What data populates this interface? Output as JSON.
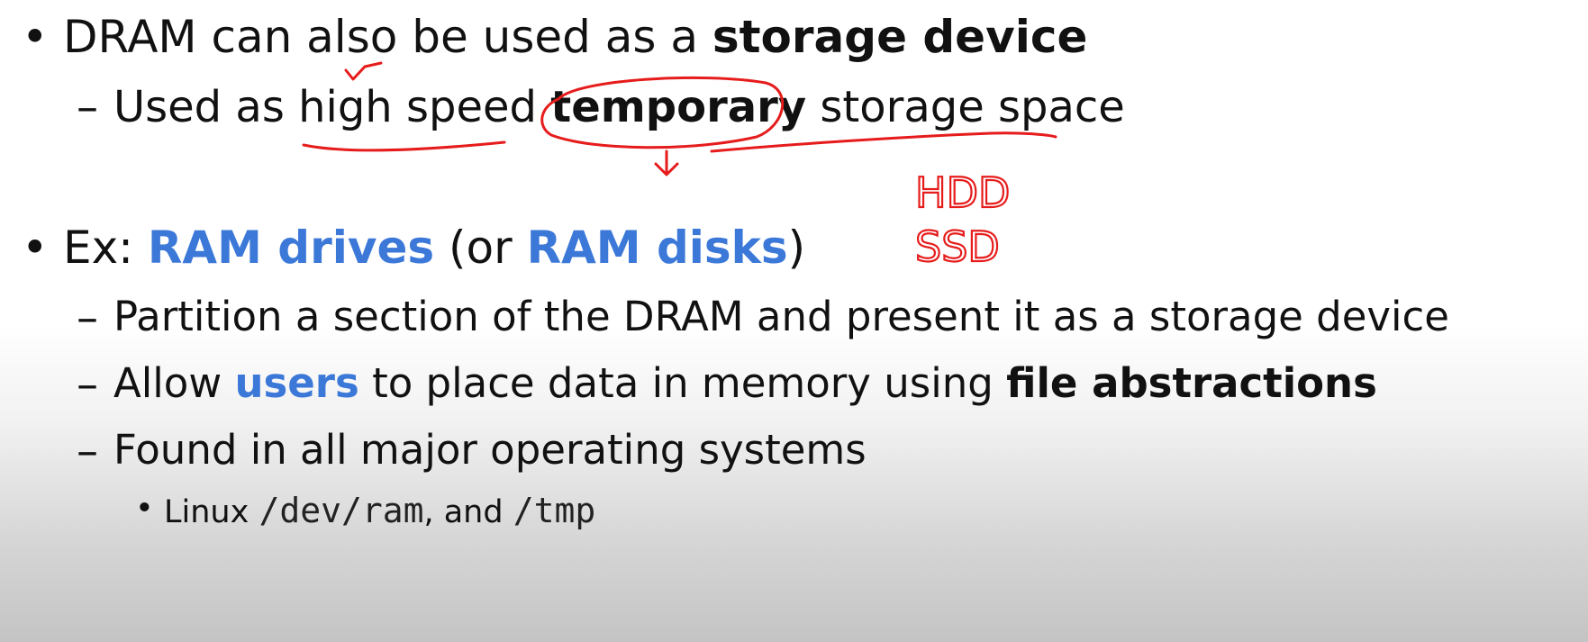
{
  "slide": {
    "items": [
      {
        "marker": "•",
        "parts": [
          {
            "text": "DRAM can also be used as a ",
            "style": "normal"
          },
          {
            "text": "storage device",
            "style": "bold"
          }
        ]
      },
      {
        "marker": "–",
        "parts": [
          {
            "text": "Used as high speed ",
            "style": "normal"
          },
          {
            "text": "temporary",
            "style": "bold"
          },
          {
            "text": " storage space",
            "style": "normal"
          }
        ]
      },
      {
        "marker": "•",
        "parts": [
          {
            "text": "Ex: ",
            "style": "normal"
          },
          {
            "text": "RAM drives",
            "style": "blue"
          },
          {
            "text": " (or ",
            "style": "normal"
          },
          {
            "text": "RAM disks",
            "style": "blue"
          },
          {
            "text": ")",
            "style": "normal"
          }
        ]
      },
      {
        "marker": "–",
        "parts": [
          {
            "text": "Partition a section of the DRAM and present it as a storage device",
            "style": "normal"
          }
        ]
      },
      {
        "marker": "–",
        "parts": [
          {
            "text": "Allow ",
            "style": "normal"
          },
          {
            "text": "users",
            "style": "blue"
          },
          {
            "text": " to place data in memory using ",
            "style": "normal"
          },
          {
            "text": "file abstractions",
            "style": "bold"
          }
        ]
      },
      {
        "marker": "–",
        "parts": [
          {
            "text": "Found in all major operating systems",
            "style": "normal"
          }
        ]
      },
      {
        "marker": "•",
        "parts": [
          {
            "text": "Linux ",
            "style": "normal"
          },
          {
            "text": "/dev/ram",
            "style": "mono"
          },
          {
            "text": ", and ",
            "style": "normal"
          },
          {
            "text": "/tmp",
            "style": "mono"
          }
        ]
      }
    ]
  },
  "annotations": {
    "handwritten": [
      "HDD",
      "SSD"
    ],
    "ink_color": "#e61c1c"
  },
  "colors": {
    "accent_blue": "#3b78d8",
    "text": "#111111"
  }
}
